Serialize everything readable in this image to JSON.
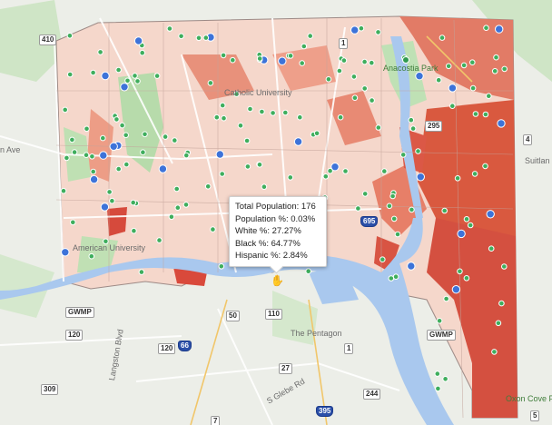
{
  "map": {
    "tooltip": {
      "rows": [
        {
          "label": "Total Population",
          "value": "176"
        },
        {
          "label": "Population %",
          "value": "0.03%"
        },
        {
          "label": "White %",
          "value": "27.27%"
        },
        {
          "label": "Black %",
          "value": "64.77%"
        },
        {
          "label": "Hispanic %",
          "value": "2.84%"
        }
      ],
      "line0": "Total Population: 176",
      "line1": "Population %: 0.03%",
      "line2": "White %: 27.27%",
      "line3": "Black %: 64.77%",
      "line4": "Hispanic %: 2.84%"
    },
    "places": {
      "american_university": "American University",
      "catholic_university": "Catholic University",
      "the_pentagon": "The Pentagon",
      "anacostia_park": "Anacostia Park",
      "oxon_cove": "Oxon Cove Pa",
      "langston_blvd": "Langston Blvd",
      "s_glebe": "S Glebe Rd",
      "suitland": "Suitlan",
      "n_ave": "n Ave"
    },
    "highways": {
      "h410": "410",
      "h1": "1",
      "h295": "295",
      "h4": "4",
      "h695": "695",
      "h50": "50",
      "h110": "110",
      "gwmp_w": "GWMP",
      "gwmp_e": "GWMP",
      "h120_w": "120",
      "h120_e": "120",
      "h309": "309",
      "h66": "66",
      "h27": "27",
      "h1s": "1",
      "h395": "395",
      "h244": "244",
      "h7": "7",
      "h5": "5"
    },
    "colors": {
      "water": "#a9c8ee",
      "park": "#b9dfb0",
      "choropleth_light": "#f4d3c7",
      "choropleth_mid": "#e99a85",
      "choropleth_dark": "#d2473a",
      "marker_green": "#3fae5d",
      "marker_blue": "#3d73d9"
    }
  }
}
